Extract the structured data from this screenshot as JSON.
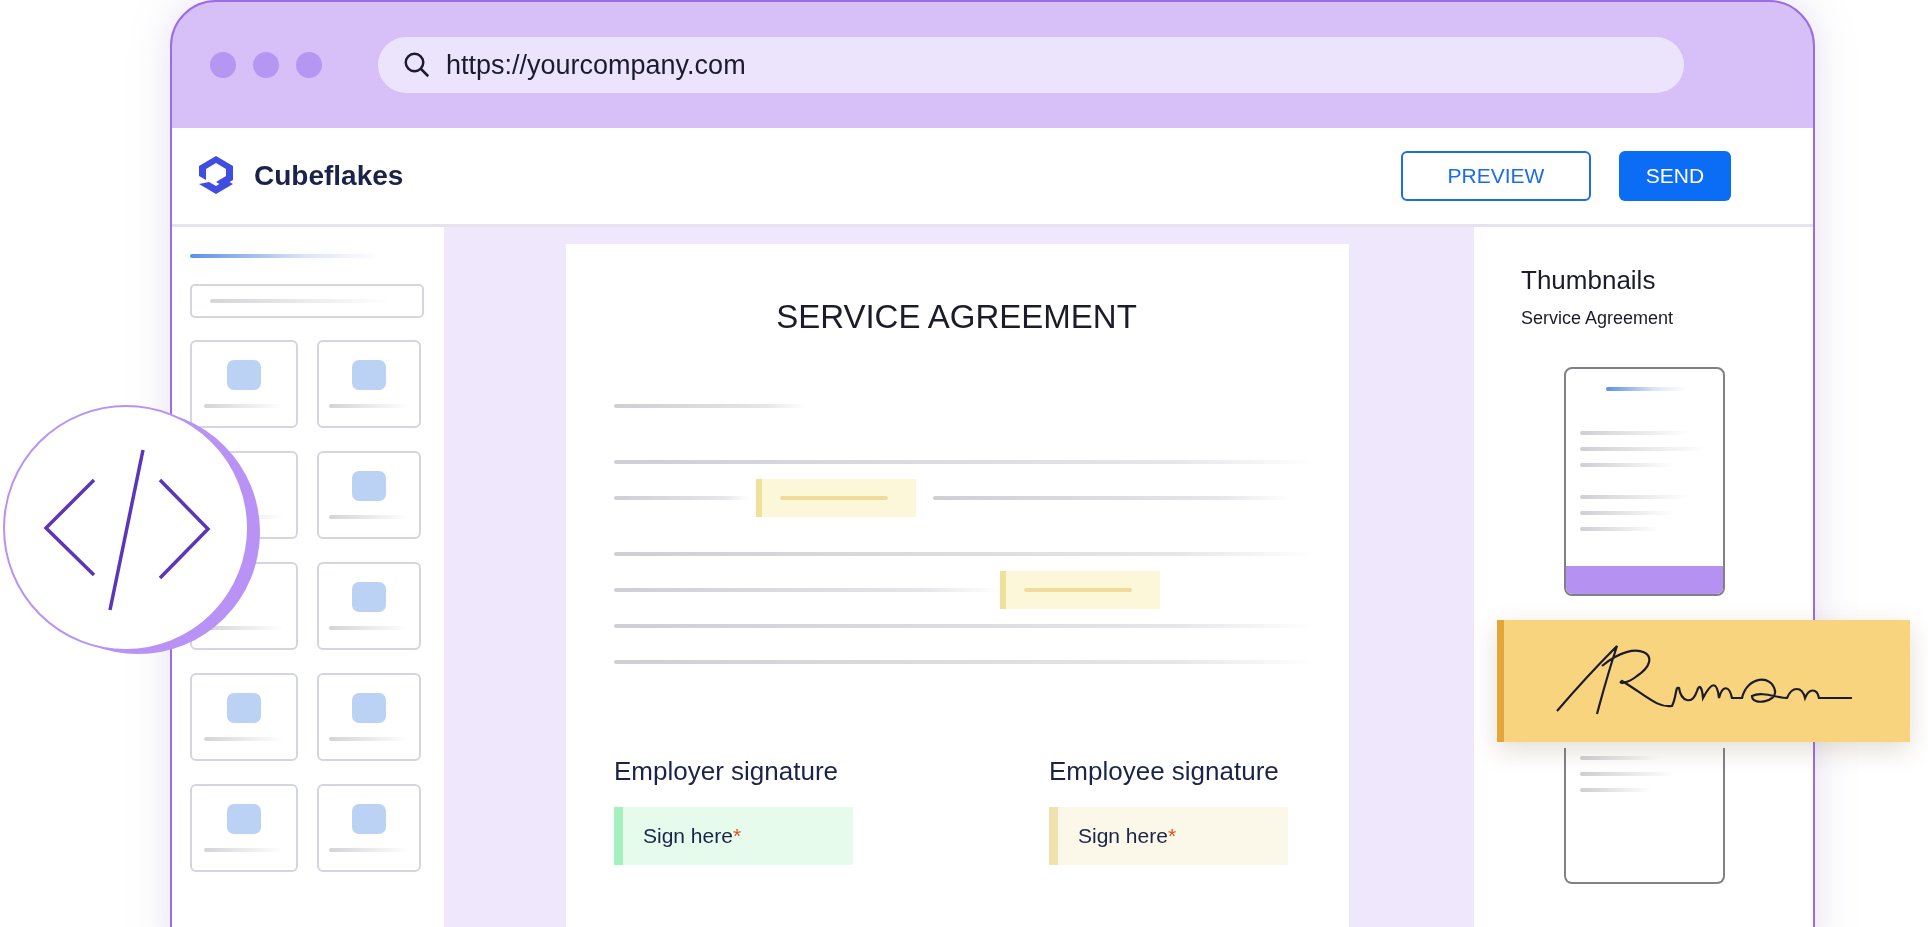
{
  "browser": {
    "url": "https://yourcompany.com"
  },
  "app": {
    "brand": "Cubeflakes",
    "buttons": [
      {
        "label": "PREVIEW",
        "kind": "outline"
      },
      {
        "label": "SEND",
        "kind": "primary"
      }
    ]
  },
  "document": {
    "title": "SERVICE AGREEMENT",
    "signatures": [
      {
        "heading": "Employer signature",
        "placeholder": "Sign here",
        "mark": "*",
        "color": "#a6f0bd"
      },
      {
        "heading": "Employee signature",
        "placeholder": "Sign here",
        "mark": "*",
        "color": "#efe2ae"
      }
    ]
  },
  "thumbnails": {
    "title": "Thumbnails",
    "subtitle": "Service Agreement"
  }
}
